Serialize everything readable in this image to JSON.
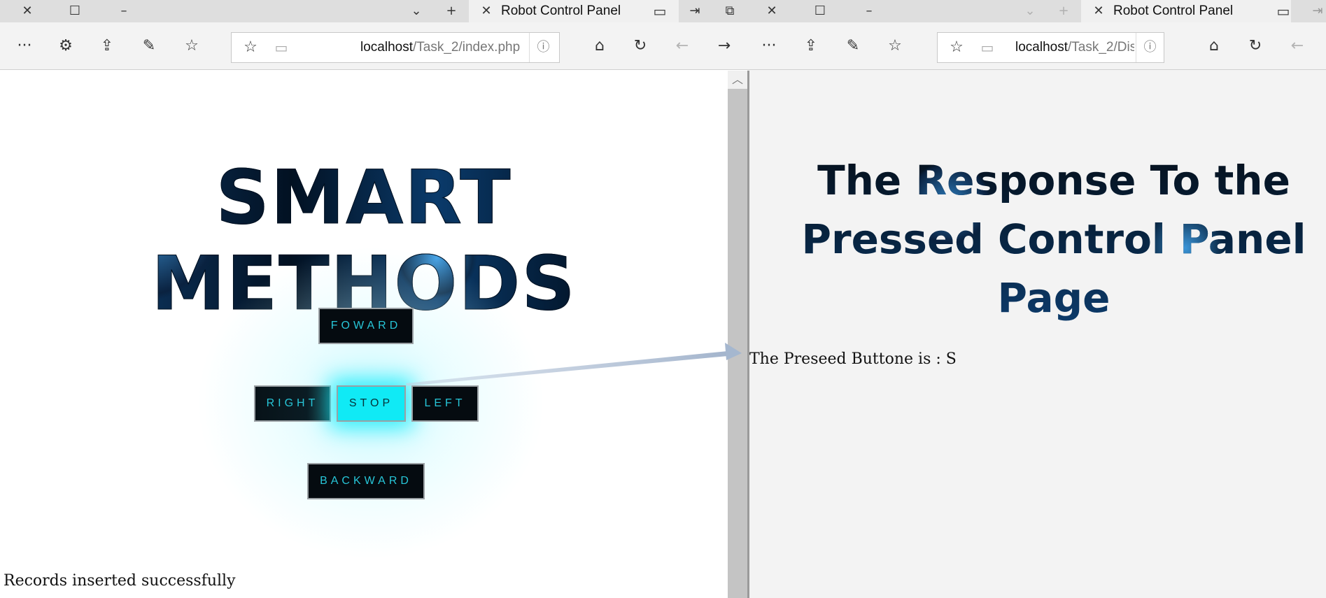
{
  "left_window": {
    "tab_title": "Robot Control Panel",
    "url_host": "localhost",
    "url_path": "/Task_2/index.php",
    "heading": "SMART METHODS",
    "controls": {
      "forward": "FOWARD",
      "right": "RIGHT",
      "stop": "STOP",
      "left": "LEFT",
      "backward": "BACKWARD"
    },
    "active_control": "stop",
    "status_message": "Records inserted successfully"
  },
  "right_window": {
    "tab_title": "Robot Control Panel",
    "url_host": "localhost",
    "url_path": "/Task_2/Dis",
    "heading_lines": [
      "The Response To the",
      "Pressed Control Panel",
      "Page"
    ],
    "pressed_label": "The Preseed Buttone is : S"
  },
  "icons": {
    "close": "✕",
    "restore": "☐",
    "minimize": "–",
    "chevron": "⌄",
    "plus": "+",
    "more": "···",
    "extensions": "⚙",
    "share": "⇪",
    "pen": "✎",
    "favorites": "☆",
    "home": "⌂",
    "refresh": "↻",
    "back": "←",
    "forward": "→",
    "info": "ⓘ",
    "reading": "▭"
  },
  "colors": {
    "button_bg": "#050b10",
    "button_text": "#27c6d8",
    "button_active": "#10eaf5"
  }
}
